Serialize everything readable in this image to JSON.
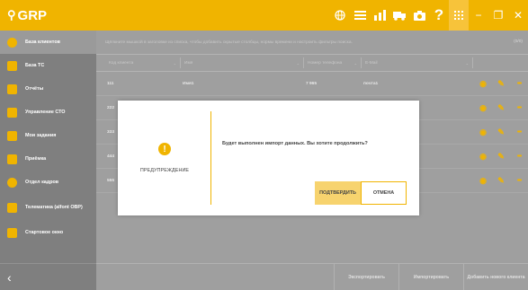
{
  "app": {
    "logo_mark": "⚲",
    "logo_text": "GRP"
  },
  "topbar_icons": [
    "globe-icon",
    "list-icon",
    "chart-icon",
    "truck-icon",
    "camera-icon",
    "help-icon",
    "grid-icon"
  ],
  "help_glyph": "?",
  "window_buttons": {
    "minimize": "−",
    "restore": "❐",
    "close": "✕"
  },
  "sidebar": {
    "items": [
      {
        "label": "База клиентов",
        "icon": "person-icon",
        "active": true
      },
      {
        "label": "База ТС",
        "icon": "car-icon",
        "active": false
      },
      {
        "label": "Отчёты",
        "icon": "report-icon",
        "active": false
      },
      {
        "label": "Управление СТО",
        "icon": "building-icon",
        "active": false
      },
      {
        "label": "Мои задания",
        "icon": "tasks-icon",
        "active": false
      },
      {
        "label": "Приёмка",
        "icon": "reception-icon",
        "active": false
      },
      {
        "label": "Отдел кадров",
        "icon": "staff-icon",
        "active": false
      },
      {
        "label": "Телематика (alfont OBP)",
        "icon": "telematics-icon",
        "active": false
      },
      {
        "label": "Стартовое окно",
        "icon": "home-icon",
        "active": false
      }
    ],
    "collapse_glyph": "‹"
  },
  "main": {
    "hint": "Щёлкните мышкой в заголовке из списка, чтобы добавить скрытые столбцы, нормы времени и настроить фильтры поиска.",
    "pager": "(0/0)",
    "filters": [
      {
        "label": "Код клиента",
        "caret": "⌄"
      },
      {
        "label": "Имя",
        "caret": "⌄"
      },
      {
        "label": "Номер телефона",
        "caret": "⌄"
      },
      {
        "label": "E-Mail",
        "caret": "⌄"
      }
    ],
    "rows": [
      {
        "code": "111",
        "name": "Имя1",
        "phone": "7 965",
        "email": "почта1"
      },
      {
        "code": "222",
        "name": "",
        "phone": "",
        "email": ""
      },
      {
        "code": "333",
        "name": "",
        "phone": "",
        "email": ""
      },
      {
        "code": "444",
        "name": "",
        "phone": "",
        "email": ""
      },
      {
        "code": "555",
        "name": "",
        "phone": "",
        "email": ""
      }
    ],
    "row_actions": {
      "view": "◉",
      "edit": "✎",
      "more": "•••"
    },
    "bottom_buttons": {
      "export": "Экспортировать",
      "import": "Импортировать",
      "add": "Добавить нового клиента"
    }
  },
  "dialog": {
    "icon_glyph": "!",
    "title": "ПРЕДУПРЕЖДЕНИЕ",
    "message": "Будет выполнен импорт данных. Вы хотите продолжить?",
    "confirm": "ПОДТВЕРДИТЬ",
    "cancel": "ОТМЕНА"
  },
  "colors": {
    "accent": "#f0b400",
    "sidebar": "#7f7f7f",
    "main_bg": "#9f9f9f",
    "dialog_bg": "#ffffff"
  }
}
